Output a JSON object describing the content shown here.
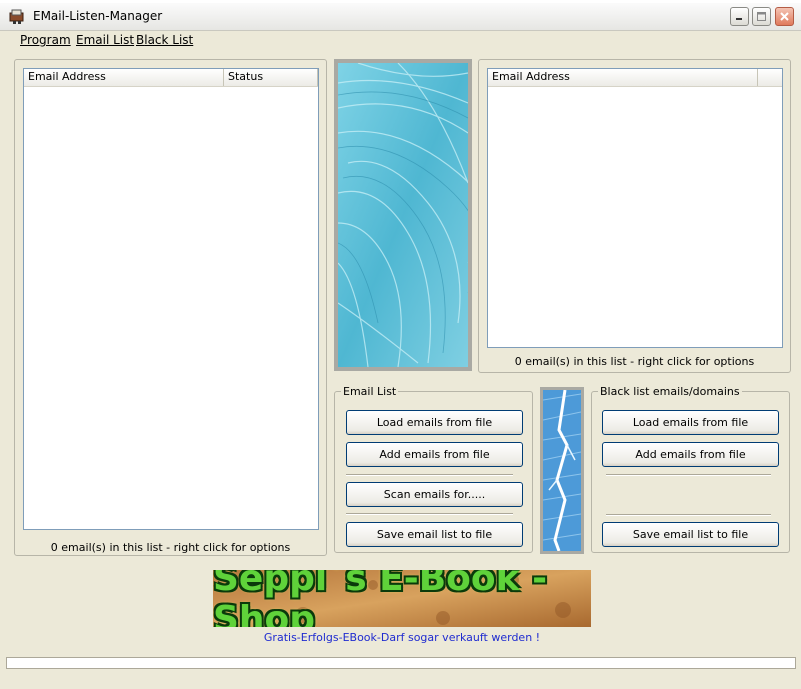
{
  "window": {
    "title": "EMail-Listen-Manager",
    "icon": "email-manager-app-icon",
    "controls": [
      "minimize-icon",
      "maximize-icon",
      "close-icon"
    ]
  },
  "menu": [
    "Program",
    "Email List",
    "Black List"
  ],
  "email_list_view": {
    "columns": [
      "Email Address",
      "Status"
    ],
    "rows": [],
    "count_text": "0 email(s) in this list - right click for options"
  },
  "blacklist_view": {
    "columns": [
      "Email Address"
    ],
    "rows": [],
    "count_text": "0 email(s) in this list - right click for options"
  },
  "email_list_group": {
    "legend": "Email List",
    "load_button": "Load emails from file",
    "add_button": "Add emails from file",
    "scan_button": "Scan emails for.....",
    "save_button": "Save email list to file"
  },
  "blacklist_group": {
    "legend": "Black list emails/domains",
    "load_button": "Load emails from file",
    "add_button": "Add emails from file",
    "save_button": "Save email list to file"
  },
  "banner": {
    "text": "Seppl`s E-Book - Shop",
    "tagline": "Gratis-Erfolgs-EBook-Darf sogar verkauft werden !"
  },
  "colors": {
    "window_bg": "#ece9d8",
    "tagline": "#1f2bd0",
    "banner_green": "#5fd23a"
  }
}
